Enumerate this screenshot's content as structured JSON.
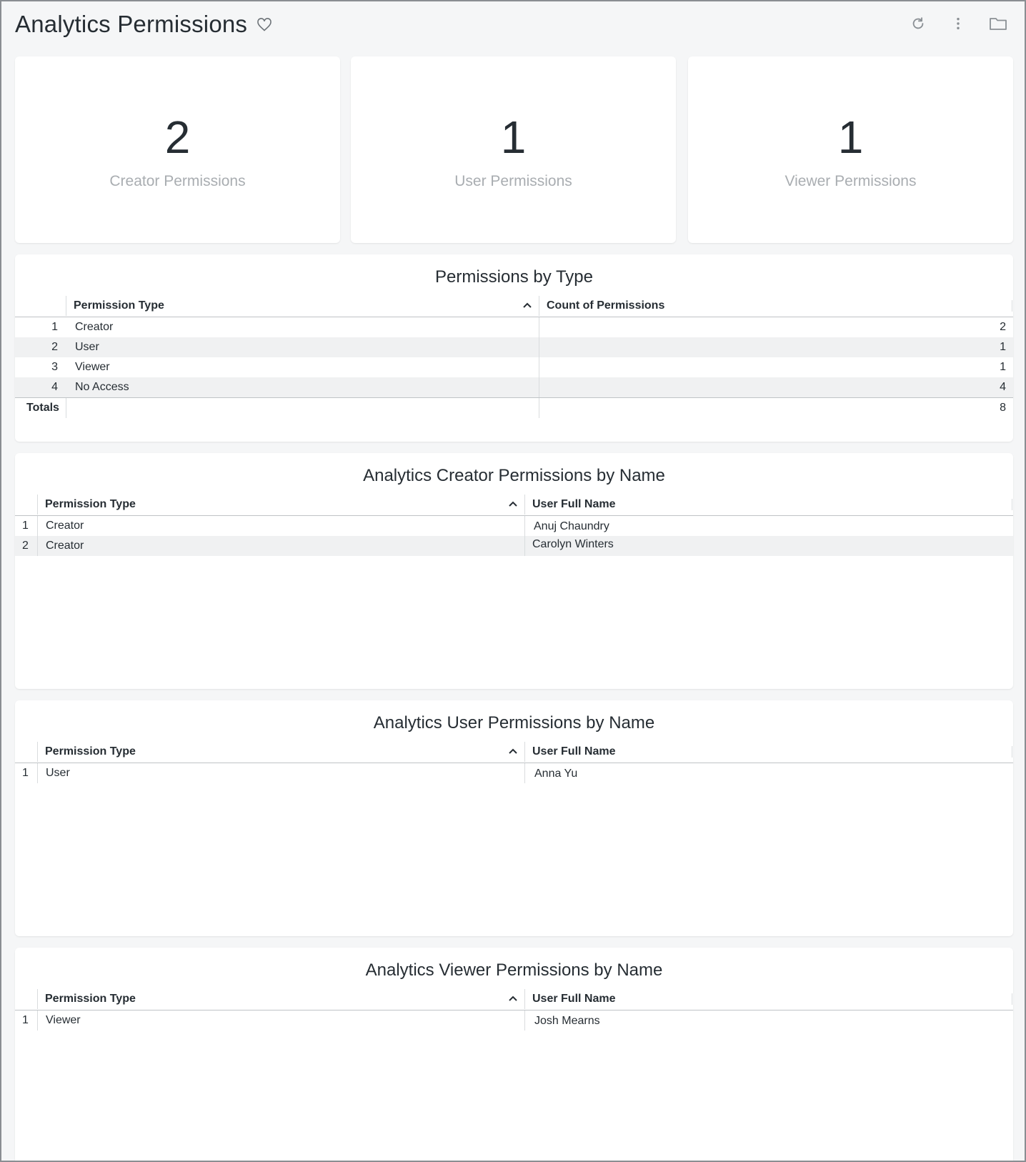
{
  "header": {
    "title": "Analytics Permissions"
  },
  "kpis": [
    {
      "value": "2",
      "label": "Creator Permissions"
    },
    {
      "value": "1",
      "label": "User Permissions"
    },
    {
      "value": "1",
      "label": "Viewer Permissions"
    }
  ],
  "by_type": {
    "title": "Permissions by Type",
    "columns": [
      "Permission Type",
      "Count of Permissions"
    ],
    "rows": [
      {
        "num": "1",
        "type": "Creator",
        "count": "2"
      },
      {
        "num": "2",
        "type": "User",
        "count": "1"
      },
      {
        "num": "3",
        "type": "Viewer",
        "count": "1"
      },
      {
        "num": "4",
        "type": "No Access",
        "count": "4"
      }
    ],
    "totals_label": "Totals",
    "totals_value": "8"
  },
  "creator": {
    "title": "Analytics Creator Permissions by Name",
    "columns": [
      "Permission Type",
      "User Full Name"
    ],
    "rows": [
      {
        "num": "1",
        "type": "Creator",
        "name": "Anuj Chaundry"
      },
      {
        "num": "2",
        "type": "Creator",
        "name": "Carolyn Winters"
      }
    ]
  },
  "user": {
    "title": "Analytics User Permissions by Name",
    "columns": [
      "Permission Type",
      "User Full Name"
    ],
    "rows": [
      {
        "num": "1",
        "type": "User",
        "name": "Anna Yu"
      }
    ]
  },
  "viewer": {
    "title": "Analytics Viewer Permissions by Name",
    "columns": [
      "Permission Type",
      "User Full Name"
    ],
    "rows": [
      {
        "num": "1",
        "type": "Viewer",
        "name": "Josh Mearns"
      }
    ]
  },
  "icons": {
    "favorite": "heart-outline-icon",
    "reload": "reload-icon",
    "more": "more-vertical-icon",
    "folder": "folder-icon",
    "sort": "chevron-up-icon"
  }
}
